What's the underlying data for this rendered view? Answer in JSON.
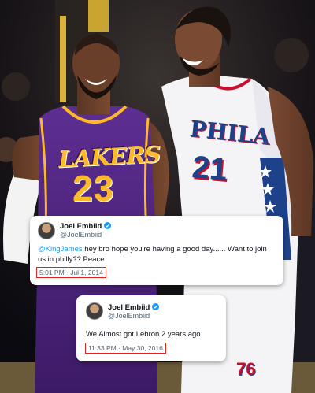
{
  "tweets": [
    {
      "name": "Joel Embiid",
      "handle": "@JoelEmbiid",
      "mention": "@KingJames",
      "text": " hey bro hope you're having a good day...... Want to join us in philly?? Peace",
      "timestamp": "5:01 PM · Jul 1, 2014"
    },
    {
      "name": "Joel Embiid",
      "handle": "@JoelEmbiid",
      "text": "We Almost got Lebron 2 years ago",
      "timestamp": "11:33 PM · May 30, 2016"
    }
  ],
  "photo": {
    "lakers_jersey_word": "LAKERS",
    "lakers_jersey_number": "23",
    "sixers_jersey_word": "PHILA",
    "sixers_jersey_number": "21",
    "sixers_logo": "76"
  },
  "colors": {
    "lakers_purple": "#552583",
    "lakers_gold": "#fdb927",
    "sixers_blue": "#1d428a",
    "sixers_red": "#c8102e",
    "twitter_blue": "#1d9bf0",
    "highlight_red": "#e0241b"
  },
  "icons": [
    "verified-badge-icon"
  ]
}
